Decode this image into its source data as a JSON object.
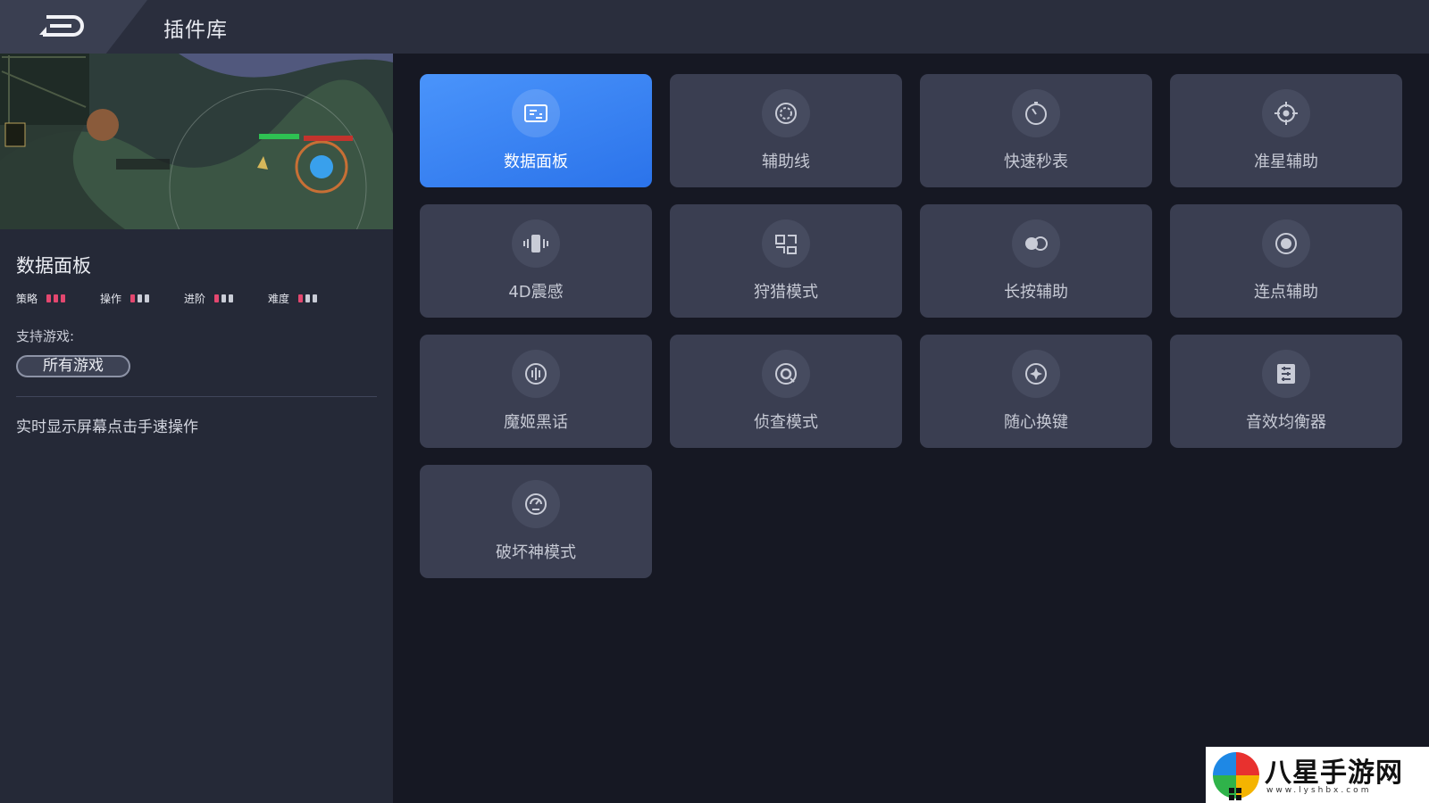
{
  "header": {
    "title": "插件库"
  },
  "detail": {
    "name": "数据面板",
    "ratings": [
      {
        "label": "策略",
        "value": 3,
        "max": 3
      },
      {
        "label": "操作",
        "value": 1,
        "max": 3
      },
      {
        "label": "进阶",
        "value": 1,
        "max": 3
      },
      {
        "label": "难度",
        "value": 1,
        "max": 3
      }
    ],
    "support_label": "支持游戏:",
    "support_game": "所有游戏",
    "description": "实时显示屏幕点击手速操作"
  },
  "plugins": [
    {
      "label": "数据面板",
      "icon": "data-panel-icon",
      "active": true
    },
    {
      "label": "辅助线",
      "icon": "guide-line-icon",
      "active": false
    },
    {
      "label": "快速秒表",
      "icon": "stopwatch-icon",
      "active": false
    },
    {
      "label": "准星辅助",
      "icon": "crosshair-icon",
      "active": false
    },
    {
      "label": "4D震感",
      "icon": "vibration-icon",
      "active": false
    },
    {
      "label": "狩猎模式",
      "icon": "hunt-mode-icon",
      "active": false
    },
    {
      "label": "长按辅助",
      "icon": "long-press-icon",
      "active": false
    },
    {
      "label": "连点辅助",
      "icon": "auto-click-icon",
      "active": false
    },
    {
      "label": "魔姬黑话",
      "icon": "voice-changer-icon",
      "active": false
    },
    {
      "label": "侦查模式",
      "icon": "scout-mode-icon",
      "active": false
    },
    {
      "label": "随心换键",
      "icon": "key-remap-icon",
      "active": false
    },
    {
      "label": "音效均衡器",
      "icon": "equalizer-icon",
      "active": false
    },
    {
      "label": "破坏神模式",
      "icon": "destroyer-mode-icon",
      "active": false
    }
  ],
  "colors": {
    "accent": "#3b86f6",
    "rating_on": "#e4476f",
    "rating_off": "#c9ccd6"
  },
  "watermark": {
    "text": "八星手游网",
    "sub": "www.lyshbx.com"
  }
}
